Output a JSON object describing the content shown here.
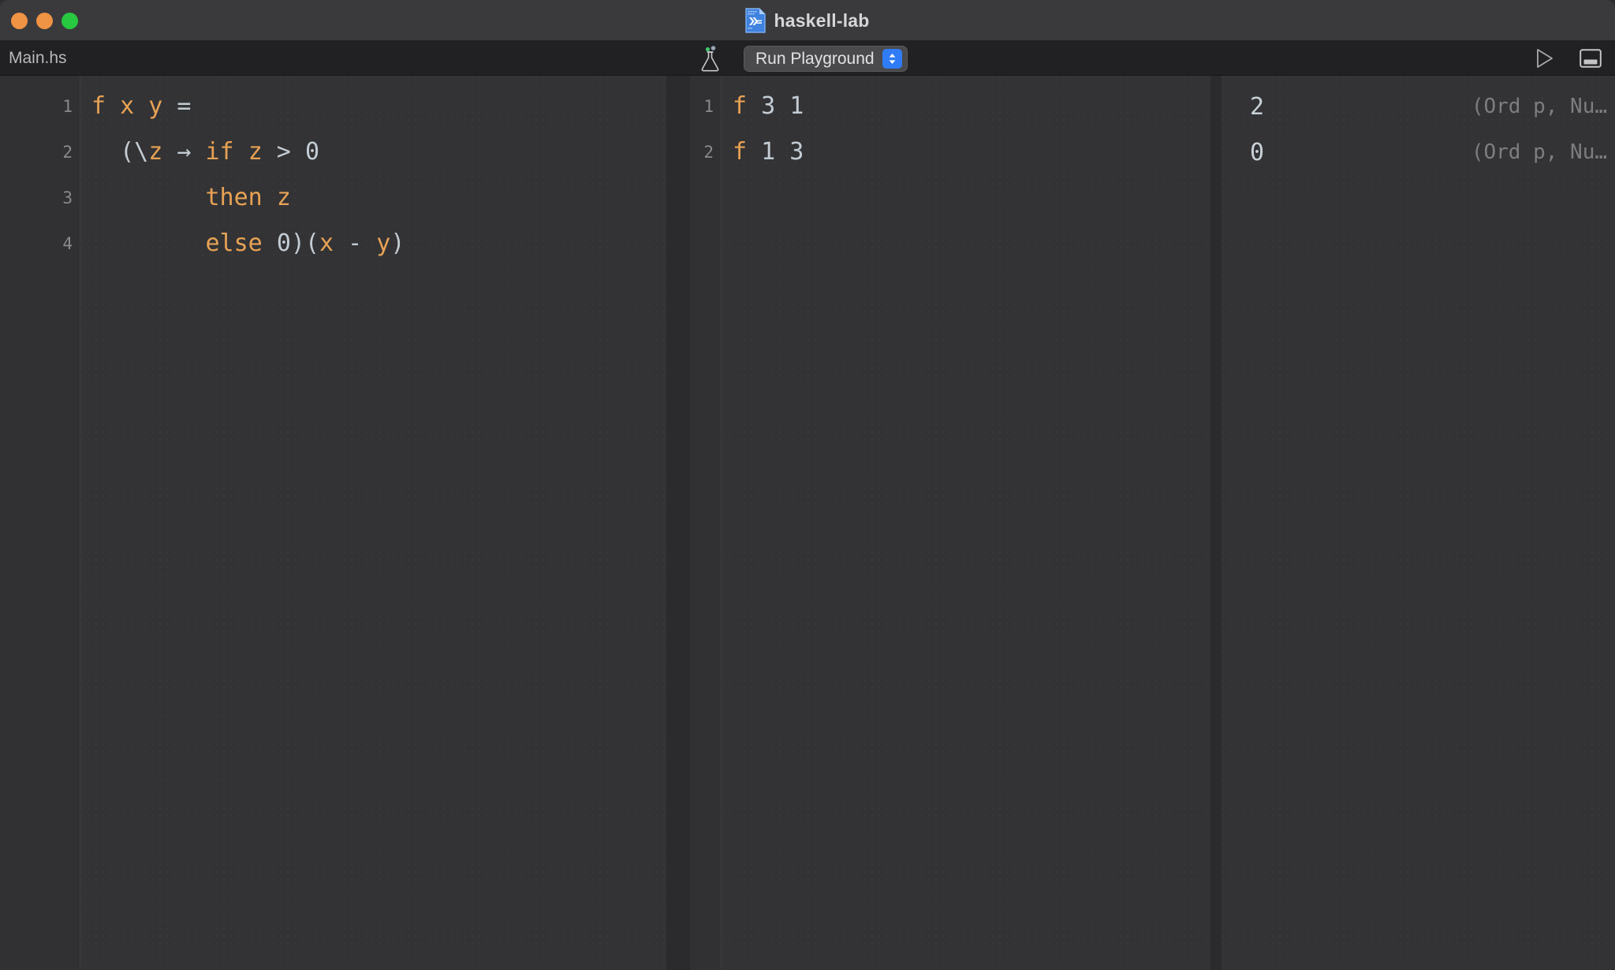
{
  "window": {
    "title": "haskell-lab",
    "doc_icon": "haskell-file-icon",
    "traffic_lights": [
      {
        "name": "close-button",
        "color": "#ef9344"
      },
      {
        "name": "minimize-button",
        "color": "#ef9344"
      },
      {
        "name": "zoom-button",
        "color": "#28c840"
      }
    ]
  },
  "toolbar": {
    "tab_label": "Main.hs",
    "flask_icon": "flask-icon",
    "run_mode_label": "Run Playground",
    "chevron_icon": "chevron-up-down-icon",
    "run_icon": "play-triangle-icon",
    "panel_icon": "bottom-panel-toggle-icon",
    "accent_blue": "#2f7cf6"
  },
  "editor": {
    "line_numbers": [
      "1",
      "2",
      "3",
      "4"
    ],
    "lines": [
      [
        {
          "t": "f",
          "c": "id"
        },
        {
          "t": " ",
          "c": "op"
        },
        {
          "t": "x",
          "c": "id"
        },
        {
          "t": " ",
          "c": "op"
        },
        {
          "t": "y",
          "c": "id"
        },
        {
          "t": " ",
          "c": "op"
        },
        {
          "t": "=",
          "c": "op"
        }
      ],
      [
        {
          "t": "  (\\",
          "c": "op"
        },
        {
          "t": "z",
          "c": "id"
        },
        {
          "t": " → ",
          "c": "op"
        },
        {
          "t": "if",
          "c": "id"
        },
        {
          "t": " ",
          "c": "op"
        },
        {
          "t": "z",
          "c": "id"
        },
        {
          "t": " > ",
          "c": "op"
        },
        {
          "t": "0",
          "c": "num"
        }
      ],
      [
        {
          "t": "        ",
          "c": "op"
        },
        {
          "t": "then",
          "c": "id"
        },
        {
          "t": " ",
          "c": "op"
        },
        {
          "t": "z",
          "c": "id"
        }
      ],
      [
        {
          "t": "        ",
          "c": "op"
        },
        {
          "t": "else",
          "c": "id"
        },
        {
          "t": " ",
          "c": "op"
        },
        {
          "t": "0",
          "c": "num"
        },
        {
          "t": ")(",
          "c": "op"
        },
        {
          "t": "x",
          "c": "id"
        },
        {
          "t": " - ",
          "c": "op"
        },
        {
          "t": "y",
          "c": "id"
        },
        {
          "t": ")",
          "c": "op"
        }
      ]
    ]
  },
  "playground": {
    "line_numbers": [
      "1",
      "2"
    ],
    "lines": [
      [
        {
          "t": "f",
          "c": "id"
        },
        {
          "t": " ",
          "c": "op"
        },
        {
          "t": "3",
          "c": "num"
        },
        {
          "t": " ",
          "c": "op"
        },
        {
          "t": "1",
          "c": "num"
        }
      ],
      [
        {
          "t": "f",
          "c": "id"
        },
        {
          "t": " ",
          "c": "op"
        },
        {
          "t": "1",
          "c": "num"
        },
        {
          "t": " ",
          "c": "op"
        },
        {
          "t": "3",
          "c": "num"
        }
      ]
    ]
  },
  "results": {
    "rows": [
      {
        "value": "2",
        "type": "(Ord p, Nu…"
      },
      {
        "value": "0",
        "type": "(Ord p, Nu…"
      }
    ]
  }
}
